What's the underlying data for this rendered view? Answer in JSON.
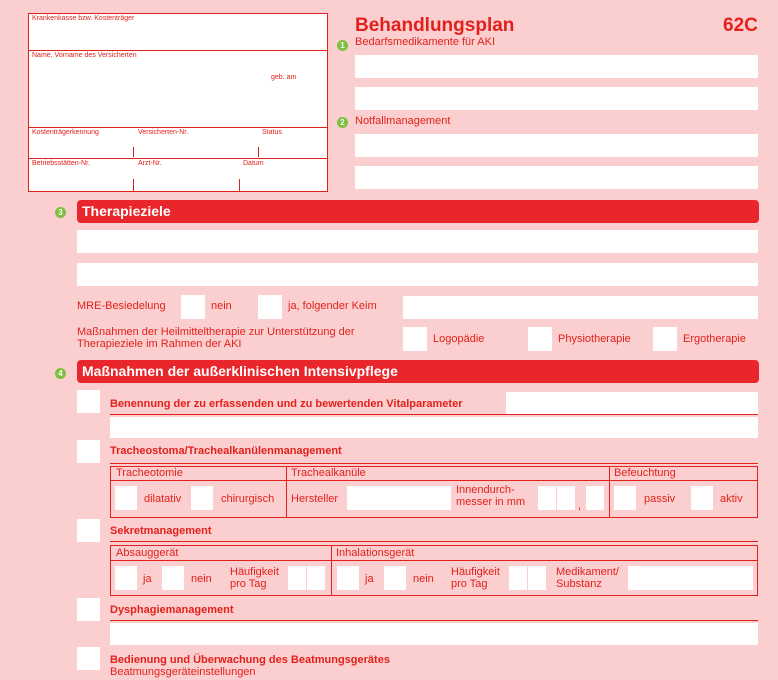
{
  "insurance_box": {
    "krankenkasse": "Krankenkasse bzw. Kostenträger",
    "name": "Name, Vorname des Versicherten",
    "geb": "geb. am",
    "kostentraegerkennung": "Kostenträgerkennung",
    "versicherten_nr": "Versicherten-Nr.",
    "status": "Status",
    "betriebsstaetten_nr": "Betriebsstätten-Nr.",
    "arzt_nr": "Arzt-Nr.",
    "datum": "Datum"
  },
  "header": {
    "title": "Behandlungsplan",
    "code": "62C"
  },
  "section1": {
    "num": "1",
    "label": "Bedarfsmedikamente für AKI"
  },
  "section2": {
    "num": "2",
    "label": "Notfallmanagement"
  },
  "section3": {
    "num": "3",
    "title": "Therapieziele",
    "mre_label": "MRE-Besiedelung",
    "nein": "nein",
    "ja_keim": "ja, folgender Keim",
    "massnahmen_label_1": "Maßnahmen der Heilmitteltherapie zur Unterstützung der",
    "massnahmen_label_2": "Therapieziele im Rahmen der AKI",
    "logopaedie": "Logopädie",
    "physiotherapie": "Physiotherapie",
    "ergotherapie": "Ergotherapie"
  },
  "section4": {
    "num": "4",
    "title": "Maßnahmen der außerklinischen Intensivpflege",
    "vital": "Benennung der zu erfassenden und zu bewertenden Vitalparameter",
    "tracheo_title": "Tracheostoma/Trachealkanülenmanagement",
    "tracheotomie": "Tracheotomie",
    "trachealkanuele": "Trachealkanüle",
    "befeuchtung": "Befeuchtung",
    "dilatativ": "dilatativ",
    "chirurgisch": "chirurgisch",
    "hersteller": "Hersteller",
    "innendurch_1": "Innendurch-",
    "innendurch_2": "messer in mm",
    "comma": ",",
    "passiv": "passiv",
    "aktiv": "aktiv",
    "sekret_title": "Sekretmanagement",
    "absauggeraet": "Absauggerät",
    "inhalationsgeraet": "Inhalationsgerät",
    "ja": "ja",
    "nein": "nein",
    "haeufigkeit_1": "Häufigkeit",
    "haeufigkeit_2": "pro Tag",
    "medikament_1": "Medikament/",
    "medikament_2": "Substanz",
    "dysphagie_title": "Dysphagiemanagement",
    "beatmung_title": "Bedienung und Überwachung des Beatmungsgerätes",
    "beatmung_sub": "Beatmungsgeräteinstellungen"
  }
}
